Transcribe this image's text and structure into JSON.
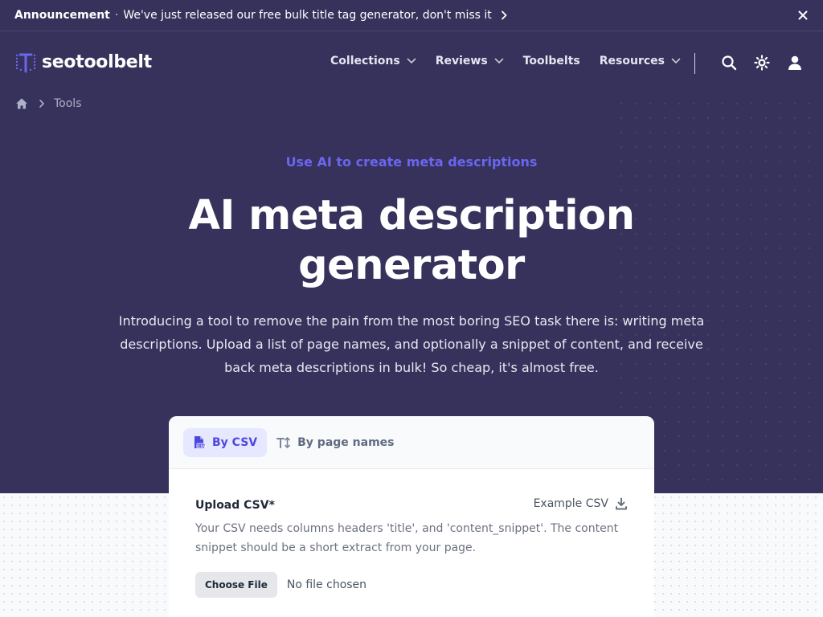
{
  "announcement": {
    "label": "Announcement",
    "separator": "·",
    "message": "We've just released our free bulk title tag generator, don't miss it"
  },
  "brand": {
    "name": "seotoolbelt",
    "accent": "#6b66f0"
  },
  "nav": {
    "items": [
      {
        "label": "Collections",
        "dropdown": true
      },
      {
        "label": "Reviews",
        "dropdown": true
      },
      {
        "label": "Toolbelts",
        "dropdown": false
      },
      {
        "label": "Resources",
        "dropdown": true
      }
    ],
    "icons": [
      "search-icon",
      "sun-icon",
      "user-icon"
    ]
  },
  "breadcrumb": {
    "items": [
      "Tools"
    ]
  },
  "hero": {
    "eyebrow": "Use AI to create meta descriptions",
    "title_line1": "AI meta description",
    "title_line2": "generator",
    "intro": "Introducing a tool to remove the pain from the most boring SEO task there is: writing meta descriptions. Upload a list of page names, and optionally a snippet of content, and receive back meta descriptions in bulk! So cheap, it's almost free."
  },
  "card": {
    "tabs": [
      {
        "label": "By CSV",
        "active": true
      },
      {
        "label": "By page names",
        "active": false
      }
    ],
    "upload": {
      "label": "Upload CSV*",
      "example_link": "Example CSV",
      "help": "Your CSV needs columns headers 'title', and 'content_snippet'. The content snippet should be a short extract from your page.",
      "button": "Choose File",
      "status": "No file chosen"
    }
  },
  "colors": {
    "hero_bg": "#36325b",
    "eyebrow": "#6b66f0",
    "active_tab_bg": "#e5e8ff",
    "active_tab_text": "#4f47dd"
  }
}
